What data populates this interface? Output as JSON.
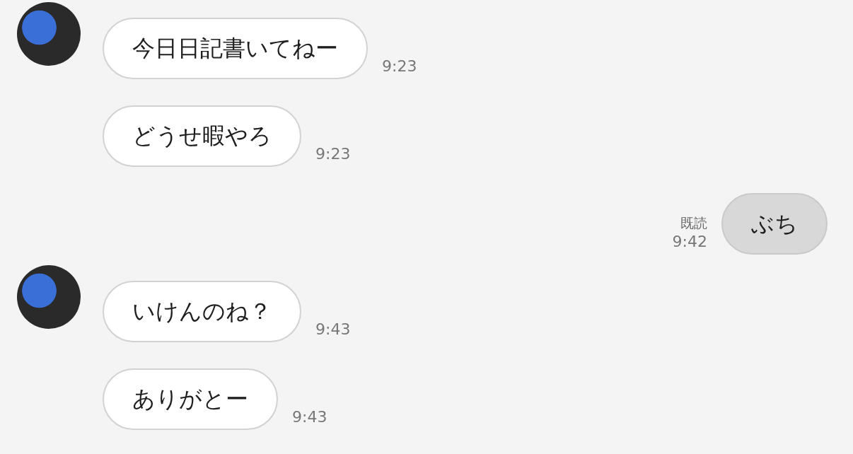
{
  "messages": [
    {
      "kind": "incoming",
      "show_avatar": true,
      "text": "今日日記書いてねー",
      "time": "9:23"
    },
    {
      "kind": "incoming",
      "show_avatar": false,
      "text": "どうせ暇やろ",
      "time": "9:23"
    },
    {
      "kind": "outgoing",
      "text": "ぶち",
      "read_label": "既読",
      "time": "9:42"
    },
    {
      "kind": "incoming",
      "show_avatar": true,
      "text": "いけんのね？",
      "time": "9:43"
    },
    {
      "kind": "incoming",
      "show_avatar": false,
      "text": "ありがとー",
      "time": "9:43"
    }
  ]
}
